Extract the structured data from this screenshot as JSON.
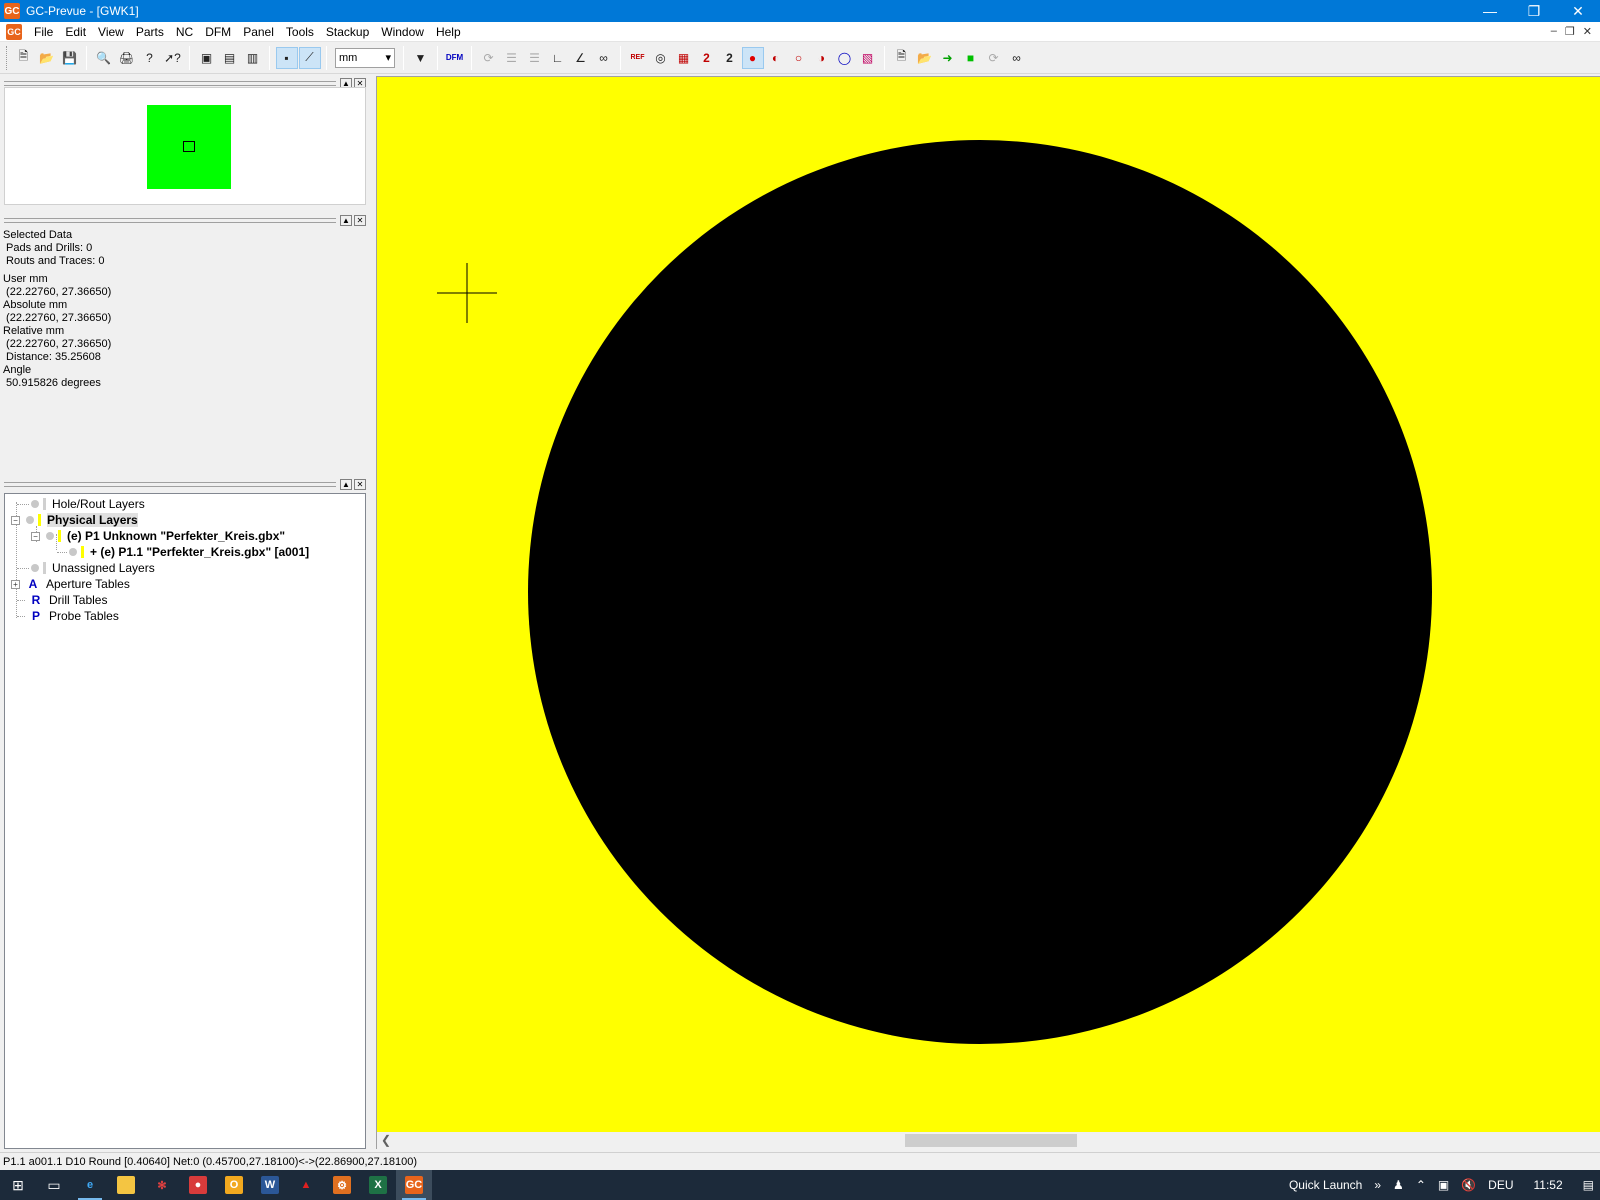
{
  "window": {
    "title": "GC-Prevue - [GWK1]",
    "app_icon": "GC"
  },
  "menu": [
    "File",
    "Edit",
    "View",
    "Parts",
    "NC",
    "DFM",
    "Panel",
    "Tools",
    "Stackup",
    "Window",
    "Help"
  ],
  "toolbar": {
    "unit": "mm",
    "dfm_label": "DFM",
    "ref_label": "REF"
  },
  "info": {
    "selected_heading": "Selected Data",
    "pads_drills": " Pads and Drills: 0",
    "routs_traces": " Routs and Traces: 0",
    "user_heading": "User mm",
    "user_value": " (22.22760, 27.36650)",
    "absolute_heading": "Absolute mm",
    "absolute_value": " (22.22760, 27.36650)",
    "relative_heading": "Relative mm",
    "relative_value": " (22.22760, 27.36650)",
    "distance": " Distance: 35.25608",
    "angle_heading": "Angle",
    "angle_value": " 50.915826 degrees"
  },
  "tree": {
    "hole_rout": "Hole/Rout Layers",
    "physical": "Physical Layers",
    "p1": "(e) P1 Unknown \"Perfekter_Kreis.gbx\"",
    "p1_1": "+ (e) P1.1 \"Perfekter_Kreis.gbx\" [a001]",
    "unassigned": "Unassigned Layers",
    "aperture": "Aperture Tables",
    "drill": "Drill Tables",
    "probe": "Probe Tables"
  },
  "status": "P1.1 a001.1 D10 Round [0.40640] Net:0 (0.45700,27.18100)<->(22.86900,27.18100)",
  "taskbar": {
    "quick_launch": "Quick Launch",
    "language": "DEU",
    "time": "11:52"
  },
  "colors": {
    "canvas_bg": "#ffff00",
    "flash": "#000000",
    "overview_board": "#00ff00"
  }
}
